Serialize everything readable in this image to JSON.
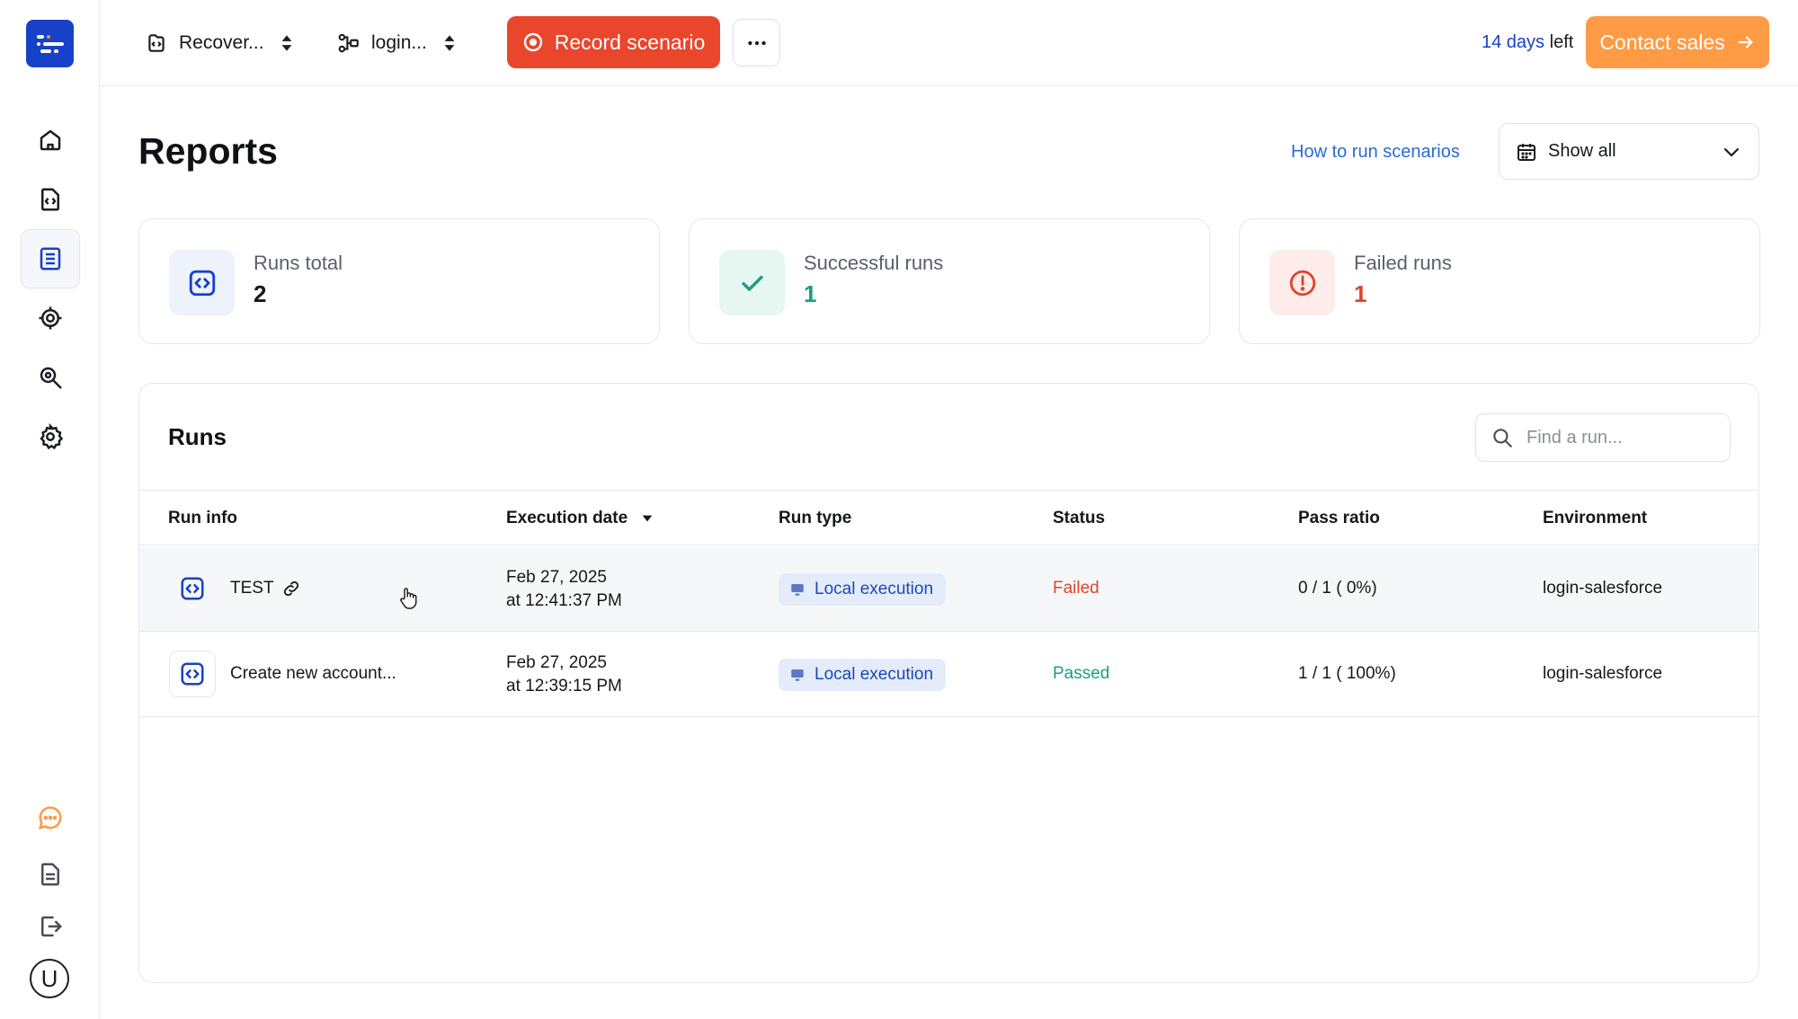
{
  "topbar": {
    "project_selector": "Recover...",
    "environment_selector": "login...",
    "record_label": "Record scenario",
    "trial_days": "14 days",
    "trial_suffix": "left",
    "contact_label": "Contact sales"
  },
  "sidebar": {
    "items": [
      "home-icon",
      "scenarios-icon",
      "reports-icon",
      "integrations-icon",
      "inspect-icon",
      "settings-icon"
    ],
    "bottom": [
      "chat-icon",
      "docs-icon",
      "logout-icon"
    ],
    "avatar_letter": "U"
  },
  "header": {
    "title": "Reports",
    "help_link": "How to run scenarios",
    "filter_value": "Show all"
  },
  "stats": [
    {
      "label": "Runs total",
      "value": "2",
      "color": "#15171c",
      "icon": "code-icon"
    },
    {
      "label": "Successful runs",
      "value": "1",
      "color": "#1a9e7e",
      "icon": "check-icon"
    },
    {
      "label": "Failed runs",
      "value": "1",
      "color": "#e0442b",
      "icon": "alert-icon"
    }
  ],
  "runs": {
    "title": "Runs",
    "search_placeholder": "Find a run...",
    "columns": [
      "Run info",
      "Execution date",
      "Run type",
      "Status",
      "Pass ratio",
      "Environment"
    ],
    "rows": [
      {
        "name": "TEST",
        "date_line1": "Feb 27, 2025",
        "date_line2": "at 12:41:37 PM",
        "type": "Local execution",
        "status": "Failed",
        "pass_ratio": "0 / 1 ( 0%)",
        "environment": "login-salesforce"
      },
      {
        "name": "Create new account...",
        "date_line1": "Feb 27, 2025",
        "date_line2": "at 12:39:15 PM",
        "type": "Local execution",
        "status": "Passed",
        "pass_ratio": "1 / 1 ( 100%)",
        "environment": "login-salesforce"
      }
    ]
  },
  "colors": {
    "brand": "#1741c9",
    "record": "#e9462c",
    "contact": "#ff9a45",
    "success": "#1a9e7e",
    "danger": "#e0442b"
  }
}
